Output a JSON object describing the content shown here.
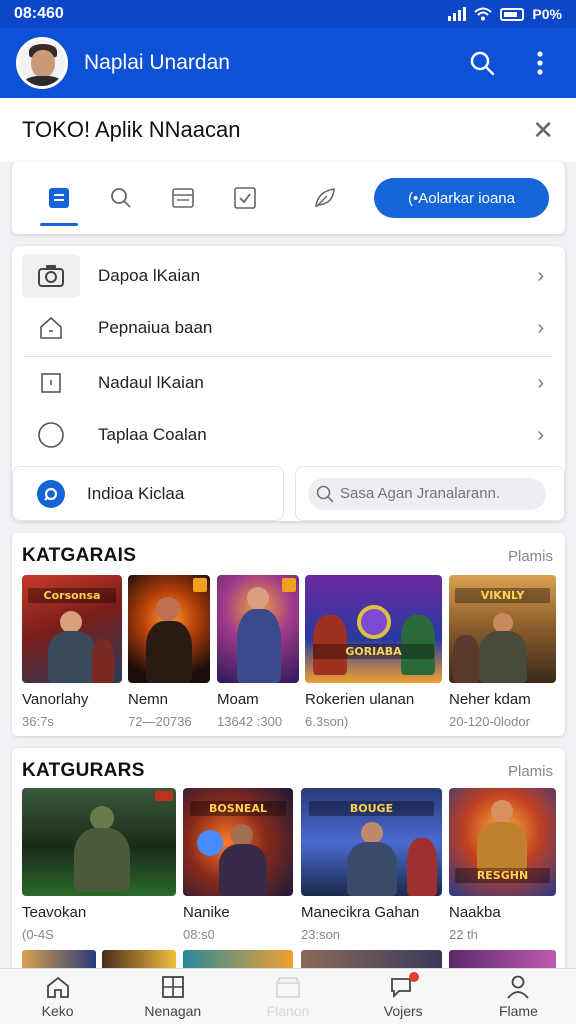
{
  "status_bar": {
    "time": "08:460",
    "battery": "P0%"
  },
  "app_bar": {
    "title": "Naplai Unardan"
  },
  "dialog": {
    "title": "TOKO! Aplik NNaacan"
  },
  "toolbar": {
    "primary_button": "(•Aolarkar ioana"
  },
  "menu": {
    "items": [
      {
        "label": "Dapoa lKaian",
        "icon": "camera-icon"
      },
      {
        "label": "Pepnaiua baan",
        "icon": "home-icon"
      },
      {
        "label": "Nadaul lKaian",
        "icon": "square-icon"
      },
      {
        "label": "Taplaa Coalan",
        "icon": "circle-icon"
      }
    ],
    "sub_link": "Indioa Kiclaa",
    "search_placeholder": "Sasa Agan Jranalarann."
  },
  "sections": [
    {
      "title": "KATGARAIS",
      "more": "Plamis",
      "apps": [
        {
          "name": "Vanorlahy",
          "meta": "36:7s",
          "art": "Corsonsa"
        },
        {
          "name": "Nemn",
          "meta": "72—20736",
          "art": ""
        },
        {
          "name": "Moam",
          "meta": "13642 :300",
          "art": ""
        },
        {
          "name": "Rokerien ulanan",
          "meta": "6.3son)",
          "art": "GORIABA"
        },
        {
          "name": "Neher kdam",
          "meta": "20-120-0lodor",
          "art": "VIKNLY RADEBS"
        }
      ]
    },
    {
      "title": "KATGURARS",
      "more": "Plamis",
      "apps": [
        {
          "name": "Teavokan",
          "meta": "(0-4S",
          "art": ""
        },
        {
          "name": "Nanike",
          "meta": "08:s0",
          "art": "BOSNEAL"
        },
        {
          "name": "Manecikra Gahan",
          "meta": "23:son",
          "art": "BOUGE"
        },
        {
          "name": "Naakba",
          "meta": "22 th",
          "art": "RESGHN"
        }
      ]
    }
  ],
  "bottom_nav": [
    {
      "label": "Keko",
      "icon": "home-icon"
    },
    {
      "label": "Nenagan",
      "icon": "grid-icon"
    },
    {
      "label": "Flanon",
      "icon": "store-icon"
    },
    {
      "label": "Vojers",
      "icon": "chat-icon"
    },
    {
      "label": "Flame",
      "icon": "profile-icon"
    }
  ],
  "colors": {
    "brand": "#0d52d6",
    "accent": "#1565d8",
    "background": "#f1f2f5"
  }
}
